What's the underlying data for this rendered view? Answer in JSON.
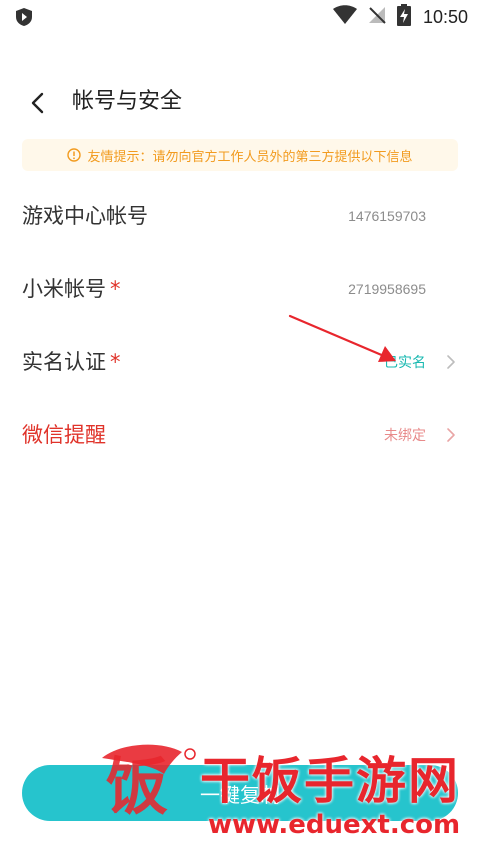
{
  "status_bar": {
    "time": "10:50",
    "icons": [
      "shield-icon",
      "wifi-icon",
      "no-signal-icon",
      "battery-charging-icon"
    ]
  },
  "header": {
    "title": "帐号与安全",
    "back_icon": "chevron-left-icon"
  },
  "notice": {
    "text": "友情提示：请勿向官方工作人员外的第三方提供以下信息",
    "icon": "alert-circle-icon",
    "color": "#f29b1f"
  },
  "rows": [
    {
      "label": "游戏中心帐号",
      "required": "",
      "value": "1476159703",
      "has_chevron": false
    },
    {
      "label": "小米帐号",
      "required": "*",
      "value": "2719958695",
      "has_chevron": false
    },
    {
      "label": "实名认证",
      "required": "*",
      "value": "已实名",
      "has_chevron": true
    },
    {
      "label": "微信提醒",
      "required": "",
      "value": "未绑定",
      "has_chevron": true
    }
  ],
  "copy_button": {
    "label": "一键复制",
    "color": "#26c4cd"
  },
  "watermark": {
    "logo_char": "饭",
    "title": "干饭手游网",
    "url": "www.eduext.com",
    "color": "#e8262d"
  },
  "colors": {
    "accent_teal": "#17b8b0",
    "required_red": "#e0332a"
  }
}
